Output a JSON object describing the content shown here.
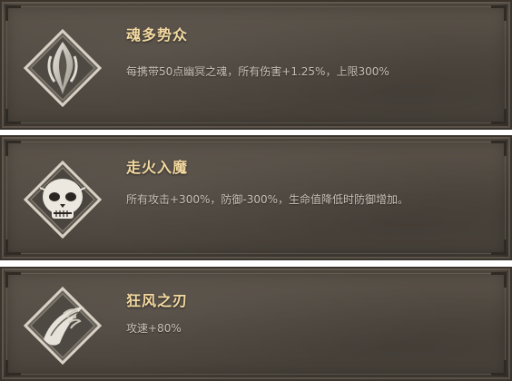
{
  "skills": [
    {
      "name": "魂多势众",
      "description": "每携带50点幽冥之魂，所有伤害+1.25%，上限300%",
      "icon": "flame-blade-icon"
    },
    {
      "name": "走火入魔",
      "description": "所有攻击+300%，防御-300%，生命值降低时防御增加。",
      "icon": "skull-mask-icon"
    },
    {
      "name": "狂风之刃",
      "description": "攻速+80%",
      "icon": "wind-blade-icon"
    }
  ],
  "colors": {
    "title": "#f3d9a0",
    "description": "#c8c2b8",
    "panel": "#514a42"
  }
}
